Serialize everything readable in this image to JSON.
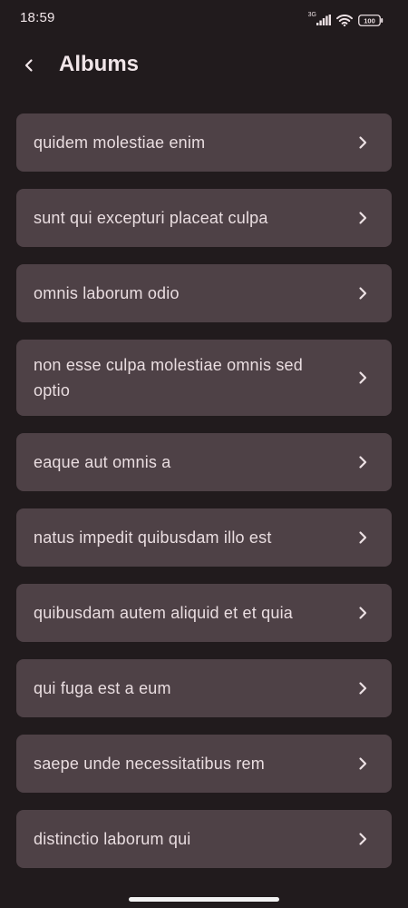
{
  "status_bar": {
    "time": "18:59",
    "network": "3G",
    "battery": "100"
  },
  "app_bar": {
    "title": "Albums",
    "back_icon": "back-chevron-icon"
  },
  "albums": [
    {
      "title": "quidem molestiae enim"
    },
    {
      "title": "sunt qui excepturi placeat culpa"
    },
    {
      "title": "omnis laborum odio"
    },
    {
      "title": "non esse culpa molestiae omnis sed optio"
    },
    {
      "title": "eaque aut omnis a"
    },
    {
      "title": "natus impedit quibusdam illo est"
    },
    {
      "title": "quibusdam autem aliquid et et quia"
    },
    {
      "title": "qui fuga est a eum"
    },
    {
      "title": "saepe unde necessitatibus rem"
    },
    {
      "title": "distinctio laborum qui"
    }
  ],
  "colors": {
    "background": "#211b1d",
    "card": "#4e4146",
    "text": "#e9dde0"
  }
}
